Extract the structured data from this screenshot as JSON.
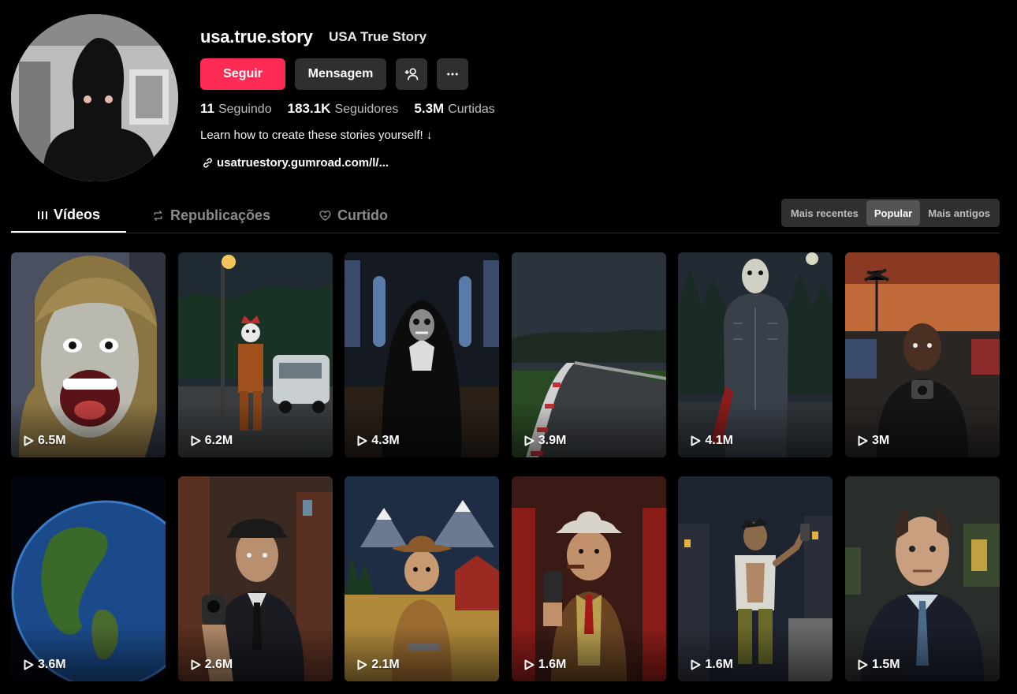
{
  "profile": {
    "username": "usa.true.story",
    "nickname": "USA True Story",
    "follow_label": "Seguir",
    "message_label": "Mensagem",
    "stats": [
      {
        "value": "11",
        "label": "Seguindo"
      },
      {
        "value": "183.1K",
        "label": "Seguidores"
      },
      {
        "value": "5.3M",
        "label": "Curtidas"
      }
    ],
    "bio": "Learn how to create these stories yourself! ↓",
    "link": "usatruestory.gumroad.com/l/..."
  },
  "tabs": [
    {
      "label": "Vídeos",
      "icon": "grid-icon",
      "active": true
    },
    {
      "label": "Republicações",
      "icon": "repost-icon",
      "active": false
    },
    {
      "label": "Curtido",
      "icon": "heart-icon",
      "active": false
    }
  ],
  "sort": [
    {
      "label": "Mais recentes",
      "active": false
    },
    {
      "label": "Popular",
      "active": true
    },
    {
      "label": "Mais antigos",
      "active": false
    }
  ],
  "videos": [
    {
      "views": "6.5M"
    },
    {
      "views": "6.2M"
    },
    {
      "views": "4.3M"
    },
    {
      "views": "3.9M"
    },
    {
      "views": "4.1M"
    },
    {
      "views": "3M"
    },
    {
      "views": "3.6M"
    },
    {
      "views": "2.6M"
    },
    {
      "views": "2.1M"
    },
    {
      "views": "1.6M"
    },
    {
      "views": "1.6M"
    },
    {
      "views": "1.5M"
    }
  ],
  "colors": {
    "accent": "#fe2c55",
    "button": "#2f2f2f",
    "background": "#000000"
  }
}
